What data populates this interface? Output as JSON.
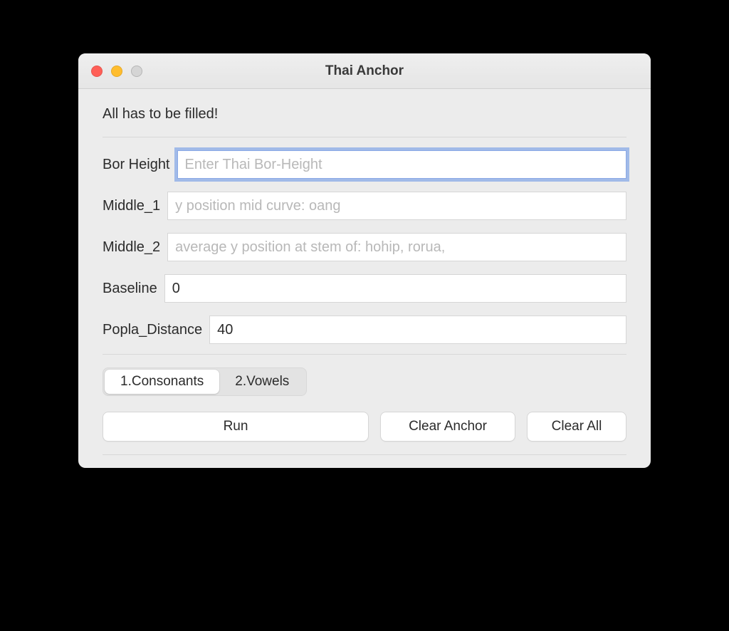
{
  "window": {
    "title": "Thai Anchor"
  },
  "heading": "All has to be filled!",
  "fields": {
    "bor_height": {
      "label": "Bor Height",
      "placeholder": "Enter Thai Bor-Height",
      "value": ""
    },
    "middle_1": {
      "label": "Middle_1",
      "placeholder": "y position mid curve: oang",
      "value": ""
    },
    "middle_2": {
      "label": "Middle_2",
      "placeholder": "average y position at stem of: hohip, rorua,",
      "value": ""
    },
    "baseline": {
      "label": "Baseline",
      "placeholder": "",
      "value": "0"
    },
    "popla_distance": {
      "label": "Popla_Distance",
      "placeholder": "",
      "value": "40"
    }
  },
  "segments": {
    "consonants": "1.Consonants",
    "vowels": "2.Vowels",
    "active": "consonants"
  },
  "buttons": {
    "run": "Run",
    "clear_anchor": "Clear Anchor",
    "clear_all": "Clear All"
  }
}
